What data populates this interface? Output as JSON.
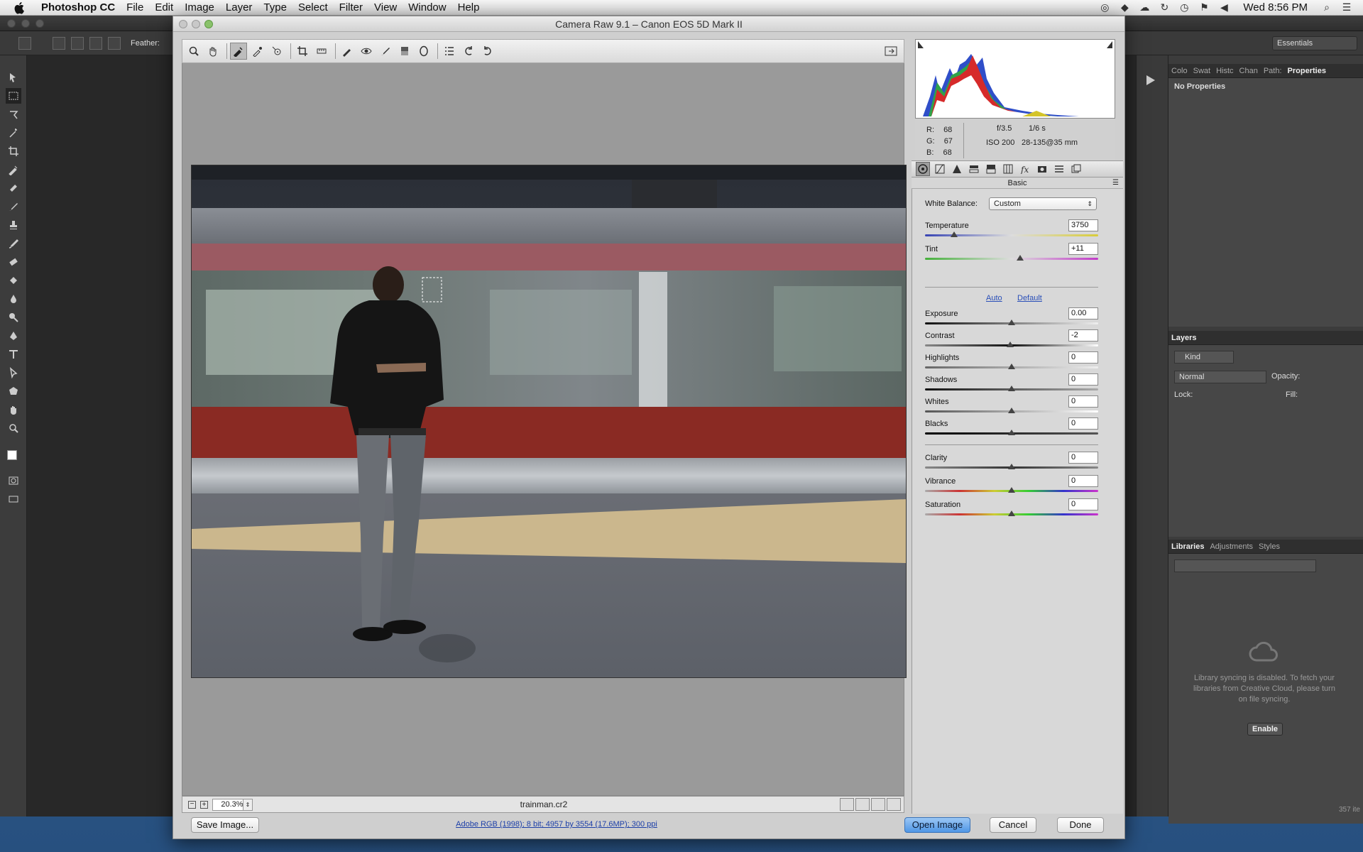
{
  "menubar": {
    "app_name": "Photoshop CC",
    "items": [
      "File",
      "Edit",
      "Image",
      "Layer",
      "Type",
      "Select",
      "Filter",
      "View",
      "Window",
      "Help"
    ],
    "clock": "Wed 8:56 PM"
  },
  "ps": {
    "options_feather_label": "Feather:",
    "workspace": "Essentials",
    "panels_top_tabs": [
      "Colo",
      "Swat",
      "Histc",
      "Chan",
      "Path:",
      "Properties"
    ],
    "properties_text": "No Properties",
    "layers_title": "Layers",
    "layers_kind": "Kind",
    "layers_blend": "Normal",
    "layers_opacity_label": "Opacity:",
    "layers_lock_label": "Lock:",
    "layers_fill_label": "Fill:",
    "libraries_tabs": [
      "Libraries",
      "Adjustments",
      "Styles"
    ],
    "library_message": "Library syncing is disabled. To fetch your libraries from Creative Cloud, please turn on file syncing.",
    "enable_button": "Enable",
    "item_count": "357 ite"
  },
  "camera_raw": {
    "title": "Camera Raw 9.1  –  Canon EOS 5D Mark II",
    "rgb": {
      "r_label": "R:",
      "r": "68",
      "g_label": "G:",
      "g": "67",
      "b_label": "B:",
      "b": "68"
    },
    "exif": {
      "aperture": "f/3.5",
      "shutter": "1/6 s",
      "iso": "ISO 200",
      "lens": "28-135@35 mm"
    },
    "panel_title": "Basic",
    "white_balance_label": "White Balance:",
    "white_balance_value": "Custom",
    "auto_link": "Auto",
    "default_link": "Default",
    "sliders": {
      "temperature": {
        "label": "Temperature",
        "value": "3750",
        "level": 0.17
      },
      "tint": {
        "label": "Tint",
        "value": "+11",
        "level": 0.55
      },
      "exposure": {
        "label": "Exposure",
        "value": "0.00",
        "level": 0.5
      },
      "contrast": {
        "label": "Contrast",
        "value": "-2",
        "level": 0.49
      },
      "highlights": {
        "label": "Highlights",
        "value": "0",
        "level": 0.5
      },
      "shadows": {
        "label": "Shadows",
        "value": "0",
        "level": 0.5
      },
      "whites": {
        "label": "Whites",
        "value": "0",
        "level": 0.5
      },
      "blacks": {
        "label": "Blacks",
        "value": "0",
        "level": 0.5
      },
      "clarity": {
        "label": "Clarity",
        "value": "0",
        "level": 0.5
      },
      "vibrance": {
        "label": "Vibrance",
        "value": "0",
        "level": 0.5
      },
      "saturation": {
        "label": "Saturation",
        "value": "0",
        "level": 0.5
      }
    },
    "zoom": "20.3%",
    "filename": "trainman.cr2",
    "workflow_link": "Adobe RGB (1998); 8 bit; 4957 by 3554 (17.6MP); 300 ppi",
    "save_button": "Save Image...",
    "open_button": "Open Image",
    "cancel_button": "Cancel",
    "done_button": "Done"
  }
}
